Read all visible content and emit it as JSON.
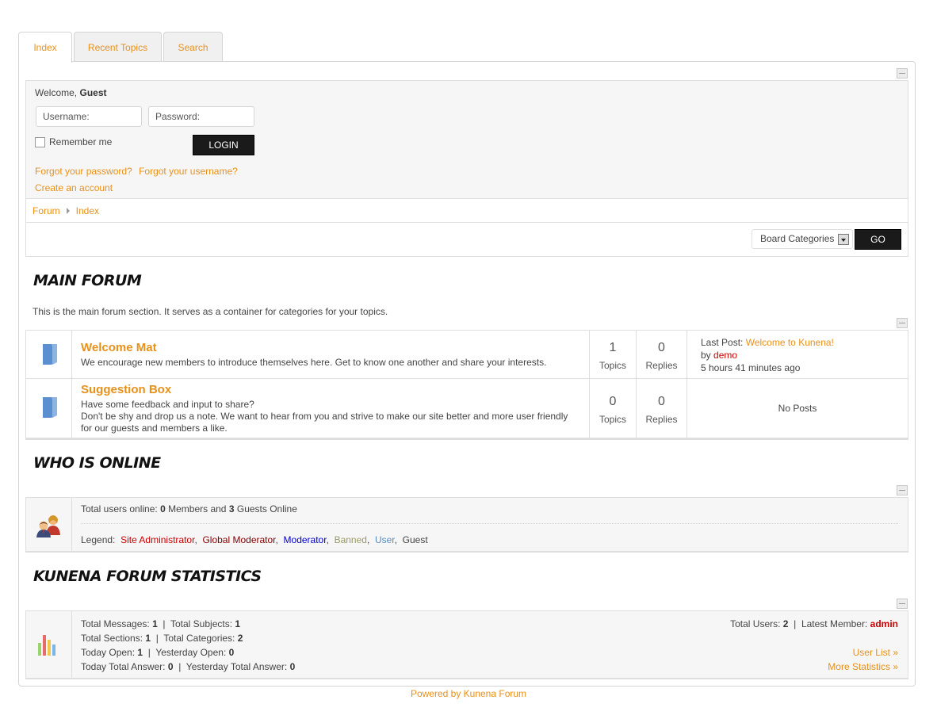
{
  "tabs": [
    {
      "label": "Index",
      "active": true
    },
    {
      "label": "Recent Topics",
      "active": false
    },
    {
      "label": "Search",
      "active": false
    }
  ],
  "login": {
    "welcome_prefix": "Welcome,",
    "welcome_user": "Guest",
    "username_placeholder": "Username:",
    "password_placeholder": "Password:",
    "remember_label": "Remember me",
    "login_button": "LOGIN",
    "forgot_password": "Forgot your password?",
    "forgot_username": "Forgot your username?",
    "create_account": "Create an account"
  },
  "breadcrumb": [
    "Forum",
    "Index"
  ],
  "jump": {
    "selected": "Board Categories",
    "go_label": "GO"
  },
  "main_forum": {
    "title": "MAIN FORUM",
    "description": "This is the main forum section. It serves as a container for categories for your topics.",
    "categories": [
      {
        "title": "Welcome Mat",
        "description": "We encourage new members to introduce themselves here. Get to know one another and share your interests.",
        "topics": "1",
        "topics_label": "Topics",
        "replies": "0",
        "replies_label": "Replies",
        "last_post_label": "Last Post:",
        "last_post_title": "Welcome to Kunena!",
        "by_label": "by",
        "author": "demo",
        "time": "5 hours 41 minutes ago"
      },
      {
        "title": "Suggestion Box",
        "description_line1": "Have some feedback and input to share?",
        "description_line2": "Don't be shy and drop us a note. We want to hear from you and strive to make our site better and more user friendly",
        "description_line3": "for our guests and members a like.",
        "topics": "0",
        "topics_label": "Topics",
        "replies": "0",
        "replies_label": "Replies",
        "no_posts": "No Posts"
      }
    ]
  },
  "who_online": {
    "title": "WHO IS ONLINE",
    "total_label": "Total users online:",
    "members": "0",
    "members_label": "Members and",
    "guests": "3",
    "guests_label": "Guests Online",
    "legend_label": "Legend:",
    "legend": [
      {
        "label": "Site Administrator",
        "color": "#cc0000"
      },
      {
        "label": "Global Moderator",
        "color": "#800000"
      },
      {
        "label": "Moderator",
        "color": "#0000cc"
      },
      {
        "label": "Banned",
        "color": "#999966"
      },
      {
        "label": "User",
        "color": "#5a8ab8"
      },
      {
        "label": "Guest",
        "color": "#444444"
      }
    ]
  },
  "stats": {
    "title": "KUNENA FORUM STATISTICS",
    "total_messages_label": "Total Messages:",
    "total_messages": "1",
    "total_subjects_label": "Total Subjects:",
    "total_subjects": "1",
    "total_sections_label": "Total Sections:",
    "total_sections": "1",
    "total_categories_label": "Total Categories:",
    "total_categories": "2",
    "today_open_label": "Today Open:",
    "today_open": "1",
    "yesterday_open_label": "Yesterday Open:",
    "yesterday_open": "0",
    "today_answer_label": "Today Total Answer:",
    "today_answer": "0",
    "yesterday_answer_label": "Yesterday Total Answer:",
    "yesterday_answer": "0",
    "total_users_label": "Total Users:",
    "total_users": "2",
    "latest_member_label": "Latest Member:",
    "latest_member": "admin",
    "user_list_link": "User List »",
    "more_stats_link": "More Statistics »"
  },
  "footer": "Powered by Kunena Forum",
  "colors": {
    "accent": "#e8911a",
    "admin": "#cc0000",
    "dark_button": "#1a1a1a"
  }
}
